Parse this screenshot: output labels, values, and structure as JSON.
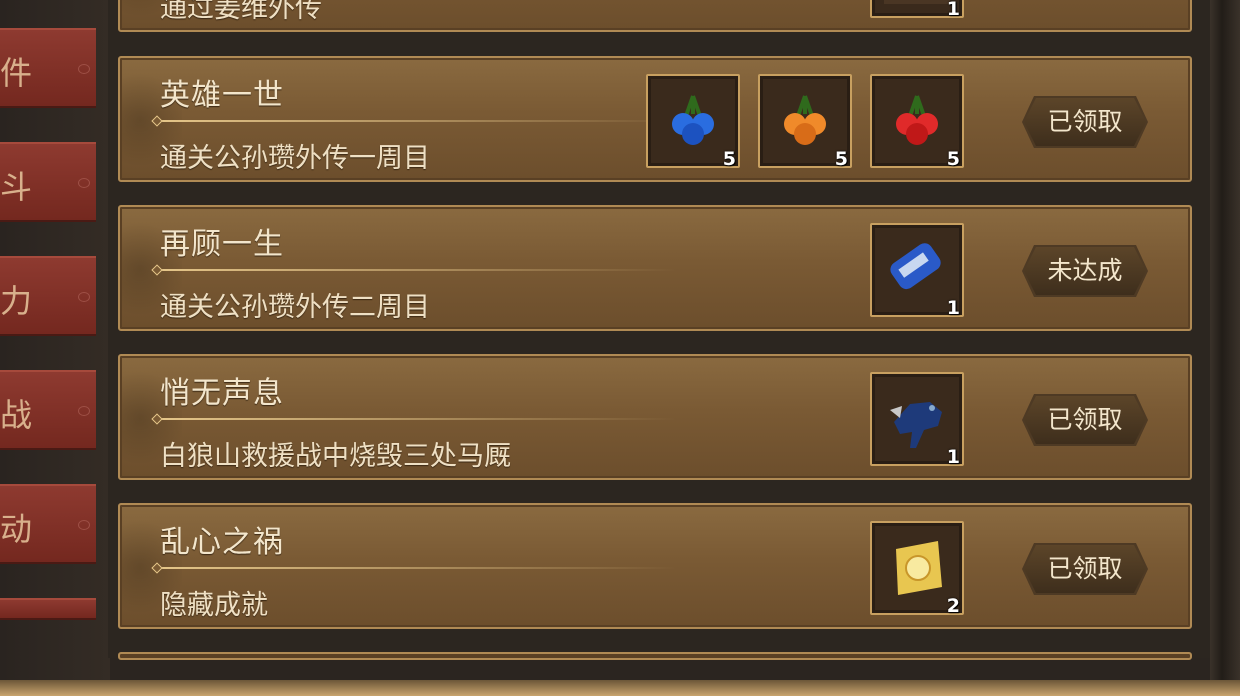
{
  "tabs": [
    {
      "label": "件"
    },
    {
      "label": "斗"
    },
    {
      "label": "力"
    },
    {
      "label": "战"
    },
    {
      "label": "动"
    }
  ],
  "achievements": [
    {
      "title": "",
      "desc": "通过姜维外传",
      "status": "",
      "rewards": [
        {
          "icon": "unknown-item-icon",
          "count": "1"
        }
      ]
    },
    {
      "title": "英雄一世",
      "desc": "通关公孙瓒外传一周目",
      "status": "已领取",
      "rewards": [
        {
          "icon": "blue-berry-icon",
          "count": "5"
        },
        {
          "icon": "orange-berry-icon",
          "count": "5"
        },
        {
          "icon": "red-berry-icon",
          "count": "5"
        }
      ]
    },
    {
      "title": "再顾一生",
      "desc": "通关公孙瓒外传二周目",
      "status": "未达成",
      "rewards": [
        {
          "icon": "blue-scroll-icon",
          "count": "1"
        }
      ]
    },
    {
      "title": "悄无声息",
      "desc": "白狼山救援战中烧毁三处马厩",
      "status": "已领取",
      "rewards": [
        {
          "icon": "armored-horse-icon",
          "count": "1"
        }
      ]
    },
    {
      "title": "乱心之祸",
      "desc": "隐藏成就",
      "status": "已领取",
      "rewards": [
        {
          "icon": "gold-ticket-icon",
          "count": "2"
        }
      ]
    }
  ]
}
